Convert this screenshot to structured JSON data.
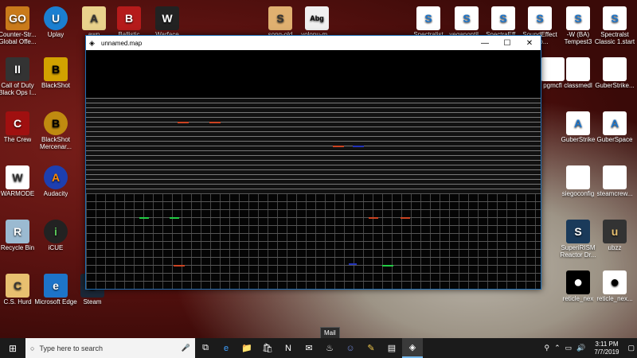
{
  "desktop": {
    "icons": [
      {
        "label": "Counter-Str... Global Offe...",
        "glyph": "GO",
        "color": "#c97a1a"
      },
      {
        "label": "Uplay",
        "glyph": "U",
        "color": "#1b7fd1"
      },
      {
        "label": "awp",
        "glyph": "A",
        "color": "#e9d28c"
      },
      {
        "label": "Ballistic",
        "glyph": "B",
        "color": "#b51b1b"
      },
      {
        "label": "Warface",
        "glyph": "W",
        "color": "#222"
      },
      {
        "label": "song-old",
        "glyph": "S",
        "color": "#e0b070"
      },
      {
        "label": "volonu-m...",
        "glyph": "Abg",
        "color": "#f0f0f0"
      },
      {
        "label": "Call of Duty Black Ops I...",
        "glyph": "II",
        "color": "#333"
      },
      {
        "label": "BlackShot",
        "glyph": "B",
        "color": "#d2a200"
      },
      {
        "label": "The Crew",
        "glyph": "C",
        "color": "#a01010"
      },
      {
        "label": "BlackShot Mercenar...",
        "glyph": "B",
        "color": "#c08a10"
      },
      {
        "label": "WARMODE",
        "glyph": "W",
        "color": "#fff"
      },
      {
        "label": "Audacity",
        "glyph": "A",
        "color": "#1d3fb0"
      },
      {
        "label": "Recycle Bin",
        "glyph": "R",
        "color": "#9bbad1"
      },
      {
        "label": "iCUE",
        "glyph": "i",
        "color": "#222"
      },
      {
        "label": "C.S. Hurd",
        "glyph": "C",
        "color": "#e8c070"
      },
      {
        "label": "Microsoft Edge",
        "glyph": "e",
        "color": "#1d74c9"
      },
      {
        "label": "Steam",
        "glyph": "S",
        "color": "#1b2838"
      },
      {
        "label": "Spectralist",
        "glyph": "S",
        "color": "#fff"
      },
      {
        "label": "veganontil...",
        "glyph": "S",
        "color": "#fff"
      },
      {
        "label": "SpectraEff...",
        "glyph": "S",
        "color": "#fff"
      },
      {
        "label": "SoundEffect Soo...",
        "glyph": "S",
        "color": "#fff"
      },
      {
        "label": "-W (BA) Tempest3",
        "glyph": "S",
        "color": "#fff"
      },
      {
        "label": "Spectralst Classic 1.start",
        "glyph": "S",
        "color": "#fff"
      },
      {
        "label": "pgmcfl",
        "glyph": "",
        "color": "#fff"
      },
      {
        "label": "classmedl",
        "glyph": "",
        "color": "#fff"
      },
      {
        "label": "GuberStrike...",
        "glyph": "",
        "color": "#fff"
      },
      {
        "label": "GuberStrike",
        "glyph": "A",
        "color": "#fff"
      },
      {
        "label": "GuberSpace",
        "glyph": "A",
        "color": "#fff"
      },
      {
        "label": "siegoconfig",
        "glyph": "",
        "color": "#fff"
      },
      {
        "label": "steamcrew...",
        "glyph": "",
        "color": "#fff"
      },
      {
        "label": "SuperiRISM Reactor Dr...",
        "glyph": "S",
        "color": "#1a3a5a"
      },
      {
        "label": "ubzz",
        "glyph": "u",
        "color": "#333"
      },
      {
        "label": "reticle_nex",
        "glyph": "●",
        "color": "#000"
      },
      {
        "label": "reticle_nex...",
        "glyph": "●",
        "color": "#fff"
      }
    ]
  },
  "window": {
    "title": "unnamed.map",
    "minimize_glyph": "—",
    "maximize_glyph": "☐",
    "close_glyph": "✕"
  },
  "taskbar": {
    "start_glyph": "⊞",
    "search_placeholder": "Type here to search",
    "mic_glyph": "🎤",
    "tooltip": "Mail",
    "pinned": [
      {
        "name": "task-view",
        "glyph": "⧉"
      },
      {
        "name": "edge",
        "glyph": "e"
      },
      {
        "name": "file-explorer",
        "glyph": "📁"
      },
      {
        "name": "store",
        "glyph": "🛍"
      },
      {
        "name": "n-app",
        "glyph": "N"
      },
      {
        "name": "mail",
        "glyph": "✉"
      },
      {
        "name": "steam",
        "glyph": "♨"
      },
      {
        "name": "discord",
        "glyph": "☺"
      },
      {
        "name": "notes",
        "glyph": "✎"
      },
      {
        "name": "documents",
        "glyph": "▤"
      },
      {
        "name": "map-editor",
        "glyph": "◈"
      }
    ],
    "time": "3:11 PM",
    "date": "7/7/2019"
  }
}
